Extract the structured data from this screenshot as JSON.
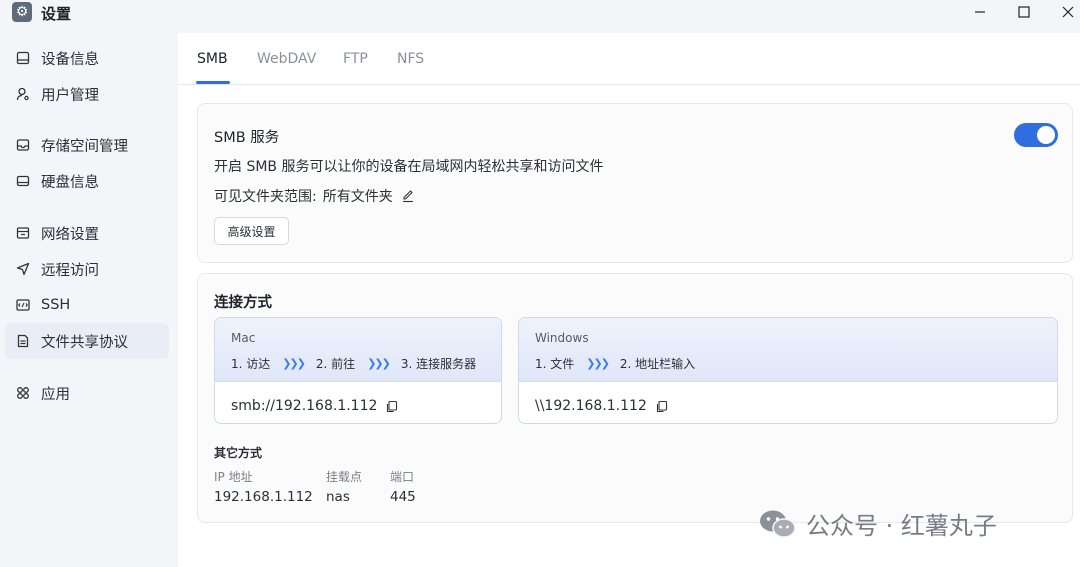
{
  "window": {
    "title": "设置",
    "minimize": "─",
    "maximize": "☐",
    "close": "✕"
  },
  "sidebar": {
    "items": [
      {
        "label": "设备信息",
        "icon": "device-info-icon"
      },
      {
        "label": "用户管理",
        "icon": "user-icon"
      },
      {
        "label": "存储空间管理",
        "icon": "storage-icon"
      },
      {
        "label": "硬盘信息",
        "icon": "disk-icon"
      },
      {
        "label": "网络设置",
        "icon": "network-icon"
      },
      {
        "label": "远程访问",
        "icon": "remote-access-icon"
      },
      {
        "label": "SSH",
        "icon": "ssh-icon"
      },
      {
        "label": "文件共享协议",
        "icon": "file-share-icon",
        "active": true
      },
      {
        "label": "应用",
        "icon": "apps-icon"
      }
    ]
  },
  "tabs": [
    "SMB",
    "WebDAV",
    "FTP",
    "NFS"
  ],
  "active_tab": "SMB",
  "smb": {
    "title": "SMB 服务",
    "enabled": true,
    "description": "开启 SMB 服务可以让你的设备在局域网内轻松共享和访问文件",
    "scope_label": "可见文件夹范围:",
    "scope_value": "所有文件夹",
    "advanced_button": "高级设置"
  },
  "connection": {
    "title": "连接方式",
    "mac": {
      "name": "Mac",
      "steps": [
        "1. 访达",
        "2. 前往",
        "3. 连接服务器"
      ],
      "path": "smb://192.168.1.112"
    },
    "windows": {
      "name": "Windows",
      "steps": [
        "1. 文件",
        "2. 地址栏输入"
      ],
      "path": "\\\\192.168.1.112"
    },
    "arrow": "❯❯❯",
    "other": {
      "title": "其它方式",
      "ip_label": "IP 地址",
      "ip_value": "192.168.1.112",
      "mount_label": "挂载点",
      "mount_value": "nas",
      "port_label": "端口",
      "port_value": "445"
    }
  },
  "watermark": "公众号 · 红薯丸子",
  "colors": {
    "accent": "#2f6ee0",
    "active_nav_bg": "#e9edf6"
  }
}
